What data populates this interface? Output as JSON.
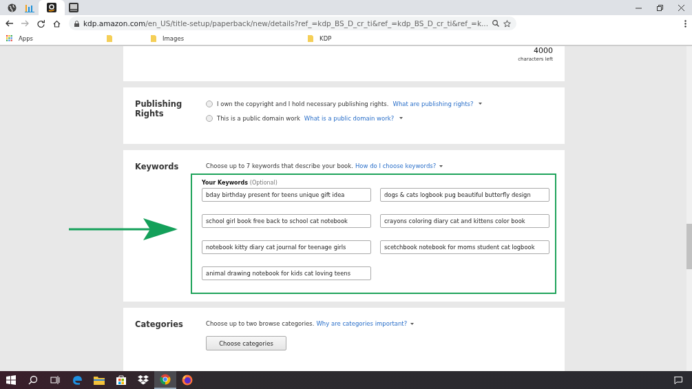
{
  "browser": {
    "tabs": [
      {
        "kind": "globe",
        "selected": false
      },
      {
        "kind": "chart",
        "selected": false
      },
      {
        "kind": "amazon",
        "selected": true
      },
      {
        "kind": "amazon-dark",
        "selected": false
      }
    ],
    "address": {
      "host": "kdp.amazon.com",
      "path": "/en_US/title-setup/paperback/new/details?ref_=kdp_BS_D_cr_ti&ref_=kdp_BS_D_cr_ti&ref_=k..."
    },
    "bookmarks": [
      {
        "kind": "apps",
        "label": "Apps"
      },
      {
        "kind": "folder"
      },
      {
        "kind": "folder",
        "label": "Images"
      },
      {
        "kind": "folder",
        "label": "KDP"
      }
    ]
  },
  "description": {
    "count": "4000",
    "count_label": "characters left"
  },
  "publishing_rights": {
    "title": "Publishing Rights",
    "options": [
      {
        "text": "I own the copyright and I hold necessary publishing rights.",
        "link": "What are publishing rights?",
        "checked": false
      },
      {
        "text": "This is a public domain work",
        "link": "What is a public domain work?",
        "checked": false
      }
    ]
  },
  "keywords": {
    "title": "Keywords",
    "intro": "Choose up to 7 keywords that describe your book.",
    "link": "How do I choose keywords?",
    "label": "Your Keywords",
    "label_note": "(Optional)",
    "values": [
      "bday birthday present for teens unique gift idea",
      "dogs & cats logbook pug beautiful butterfly design",
      "school girl book free back to school cat notebook",
      "crayons coloring diary cat and kittens color book",
      "notebook kitty diary cat journal for teenage girls",
      "scetchbook notebook for moms student cat logbook",
      "animal drawing notebook for kids cat loving teens"
    ]
  },
  "categories": {
    "title": "Categories",
    "intro": "Choose up to two browse categories.",
    "link": "Why are categories important?",
    "button": "Choose categories"
  },
  "taskbar": [
    {
      "kind": "start",
      "selected": false
    },
    {
      "kind": "search",
      "selected": false
    },
    {
      "kind": "taskview",
      "selected": false
    },
    {
      "kind": "edge",
      "selected": false
    },
    {
      "kind": "explorer",
      "selected": false
    },
    {
      "kind": "store",
      "selected": false
    },
    {
      "kind": "dropbox",
      "selected": false
    },
    {
      "kind": "chrome",
      "selected": true
    },
    {
      "kind": "firefox",
      "selected": false
    }
  ]
}
